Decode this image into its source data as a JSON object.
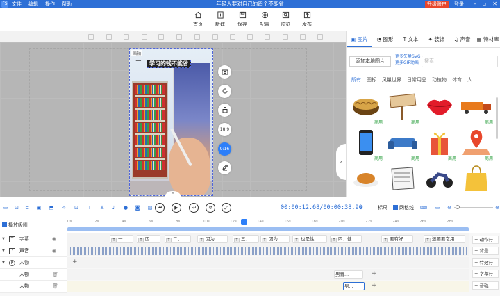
{
  "app": {
    "window_title": "年轻人要对自己的四个不能省",
    "menu": [
      "文件",
      "编辑",
      "操作",
      "帮助"
    ],
    "upgrade_label": "升级账户",
    "login_label": "登录",
    "logo_text": "FS"
  },
  "toolbar": {
    "items": [
      {
        "label": "首页",
        "icon": "home-icon"
      },
      {
        "label": "新建",
        "icon": "new-file-icon"
      },
      {
        "label": "保存",
        "icon": "save-icon"
      },
      {
        "label": "配置",
        "icon": "settings-icon"
      },
      {
        "label": "预览",
        "icon": "preview-icon"
      },
      {
        "label": "发布",
        "icon": "publish-icon"
      }
    ]
  },
  "canvas": {
    "caption_text": "学习的钱不能省",
    "scene_badge": "画轴",
    "side_tools": [
      {
        "label": "",
        "icon": "camera-icon"
      },
      {
        "label": "",
        "icon": "rotate-icon"
      },
      {
        "label": "",
        "icon": "lock-icon"
      },
      {
        "label": "18:9",
        "icon": ""
      },
      {
        "label": "9:16",
        "icon": ""
      },
      {
        "label": "",
        "icon": "edit-icon"
      }
    ]
  },
  "panel": {
    "tabs": [
      "图片",
      "图形",
      "文本",
      "装饰",
      "声音",
      "特材库"
    ],
    "active_tab": "图片",
    "add_local_label": "添加本地图片",
    "links": [
      "更多矢量SVG",
      "更多GIF动画"
    ],
    "search_placeholder": "搜索",
    "categories": [
      "所有",
      "图标",
      "风量世界",
      "日常用品",
      "动植物",
      "体育",
      "人"
    ],
    "active_category": "所有",
    "free_label": "商用"
  },
  "controls": {
    "current_time": "00:00:12.68",
    "total_time": "00:00:38.90",
    "snap_label": "吸附",
    "ruler_label": "标尺",
    "grid_label": "网格线"
  },
  "timeline": {
    "snap_label": "播放吸附",
    "ticks": [
      "0s",
      "2s",
      "4s",
      "6s",
      "8s",
      "10s",
      "12s",
      "14s",
      "16s",
      "18s",
      "20s",
      "22s",
      "24s",
      "26s",
      "28s"
    ],
    "tracks": [
      {
        "name": "字幕",
        "icon": "T"
      },
      {
        "name": "声音",
        "icon": "♪"
      },
      {
        "name": "人物",
        "icon": "P"
      },
      {
        "name": "人物",
        "icon": ""
      },
      {
        "name": "人物",
        "icon": ""
      }
    ],
    "subtitle_clips": [
      "一...",
      "因...",
      "二、...",
      "因为...",
      "三、...",
      "因为...",
      "也是性...",
      "四、健...",
      "要有好...",
      "还要要它用..."
    ],
    "person_clips": [
      "男青...",
      "男..."
    ],
    "right_buttons": [
      "+ 动作行",
      "+ 背景",
      "+ 特效行",
      "+ 字幕行",
      "+ 音轨"
    ]
  }
}
